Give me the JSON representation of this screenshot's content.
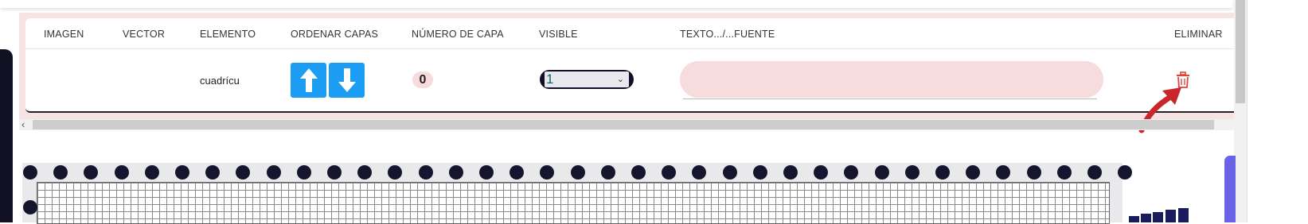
{
  "table": {
    "headers": {
      "imagen": "IMAGEN",
      "vector": "VECTOR",
      "elemento": "ELEMENTO",
      "ordenar": "ORDENAR CAPAS",
      "numero": "NÚMERO DE CAPA",
      "visible": "VISIBLE",
      "texto": "TEXTO.../...FUENTE",
      "eliminar": "ELIMINAR"
    },
    "row": {
      "elemento": "cuadrícu",
      "numero": "0",
      "visible": "1",
      "texto": ""
    }
  },
  "icons": {
    "up": "arrow-up-icon",
    "down": "arrow-down-icon",
    "trash": "trash-icon",
    "chevron": "chevron-down-icon",
    "scroll_left": "chevron-left-icon"
  },
  "colors": {
    "accent_blue": "#1a9df2",
    "panel_pink": "#f7e3e3",
    "delete_red": "#e0453d",
    "dark_navy": "#15152e",
    "purple": "#6a63e8"
  }
}
